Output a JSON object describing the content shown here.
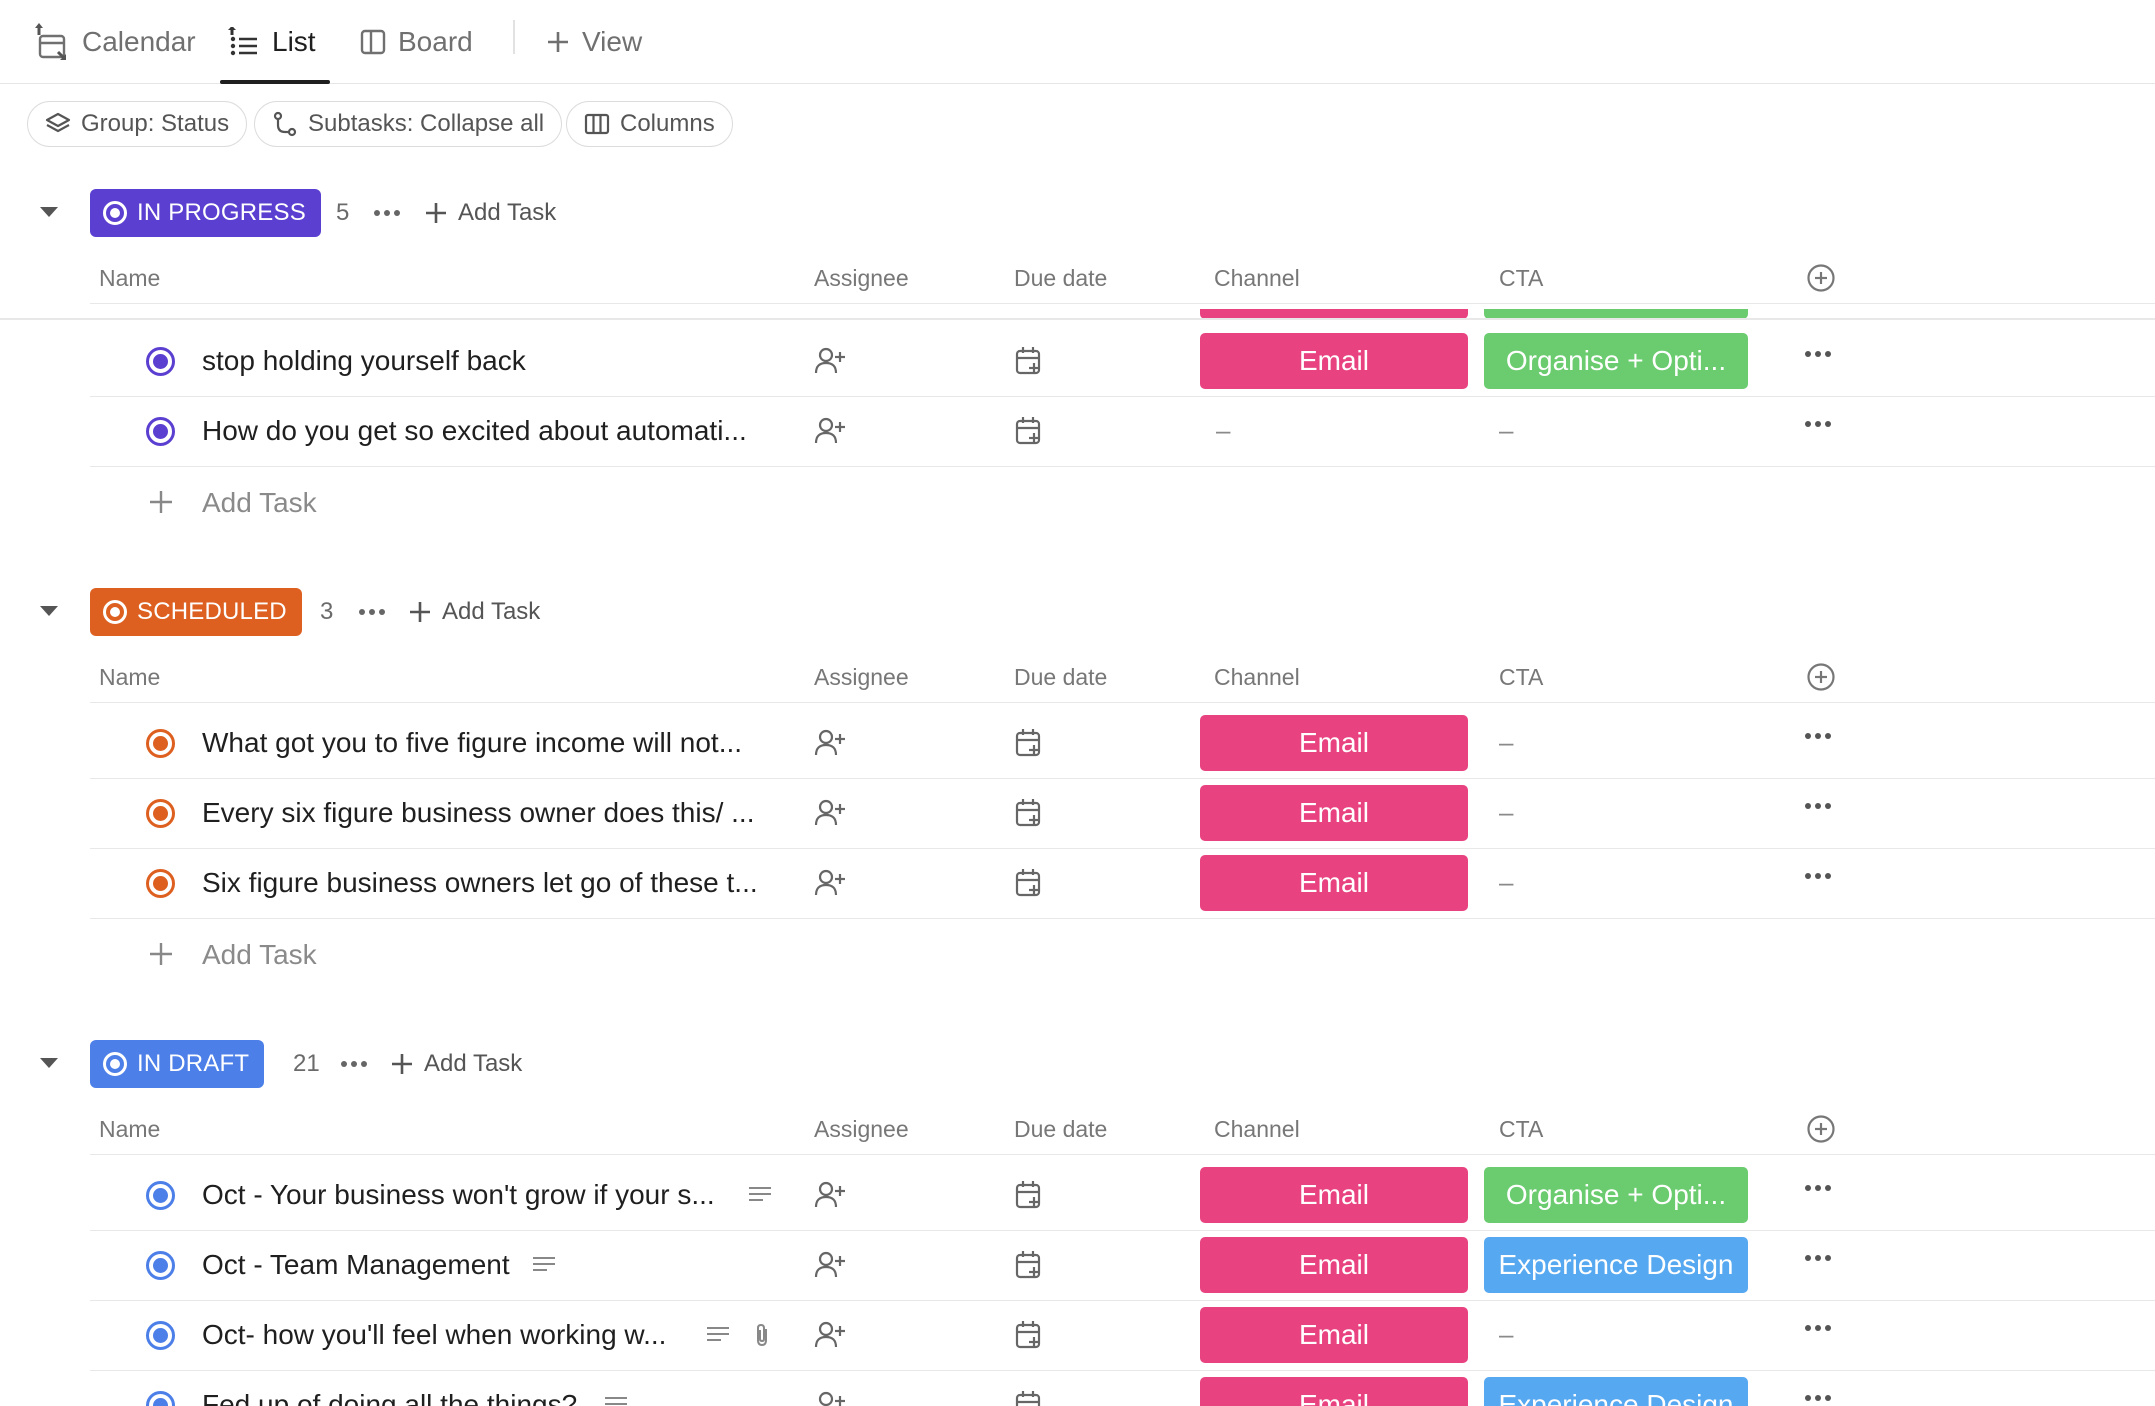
{
  "views": {
    "calendar": "Calendar",
    "list": "List",
    "board": "Board",
    "add_view": "View"
  },
  "toolbar": {
    "group": "Group: Status",
    "subtasks": "Subtasks: Collapse all",
    "columns": "Columns"
  },
  "columns": {
    "name": "Name",
    "assignee": "Assignee",
    "due_date": "Due date",
    "channel": "Channel",
    "cta": "CTA"
  },
  "colors": {
    "in_progress": "#5b3fd1",
    "scheduled": "#dd6020",
    "in_draft": "#4c7fe8",
    "email": "#e84380",
    "organise": "#6acb6f",
    "experience": "#56a8f0"
  },
  "icons": [
    "calendar-icon",
    "list-icon",
    "board-icon",
    "plus-icon",
    "layers-icon",
    "subtask-icon",
    "columns-icon",
    "caret-down-icon",
    "more-icon",
    "add-assignee-icon",
    "add-date-icon",
    "add-column-icon",
    "description-icon",
    "paperclip-icon"
  ],
  "groups": {
    "in_progress": {
      "label": "IN PROGRESS",
      "count": "5",
      "add_task": "Add Task",
      "tasks": [
        {
          "name": "stop holding yourself back",
          "channel": "Email",
          "cta": "Organise + Opti..."
        },
        {
          "name": "How do you get so excited about automati...",
          "channel": "–",
          "cta": "–"
        }
      ],
      "add_row": "Add Task"
    },
    "scheduled": {
      "label": "SCHEDULED",
      "count": "3",
      "add_task": "Add Task",
      "tasks": [
        {
          "name": "What got you to five figure income will not...",
          "channel": "Email",
          "cta": "–"
        },
        {
          "name": "Every six figure business owner does this/ ...",
          "channel": "Email",
          "cta": "–"
        },
        {
          "name": "Six figure business owners let go of these t...",
          "channel": "Email",
          "cta": "–"
        }
      ],
      "add_row": "Add Task"
    },
    "in_draft": {
      "label": "IN DRAFT",
      "count": "21",
      "add_task": "Add Task",
      "tasks": [
        {
          "name": "Oct - Your business won't grow if your s...",
          "channel": "Email",
          "cta": "Organise + Opti..."
        },
        {
          "name": "Oct - Team Management",
          "channel": "Email",
          "cta": "Experience Design"
        },
        {
          "name": "Oct- how you'll feel when working w...",
          "channel": "Email",
          "cta": "–"
        },
        {
          "name": "Fed up of doing all the things?",
          "channel": "Email",
          "cta": "Experience Design"
        }
      ]
    }
  }
}
